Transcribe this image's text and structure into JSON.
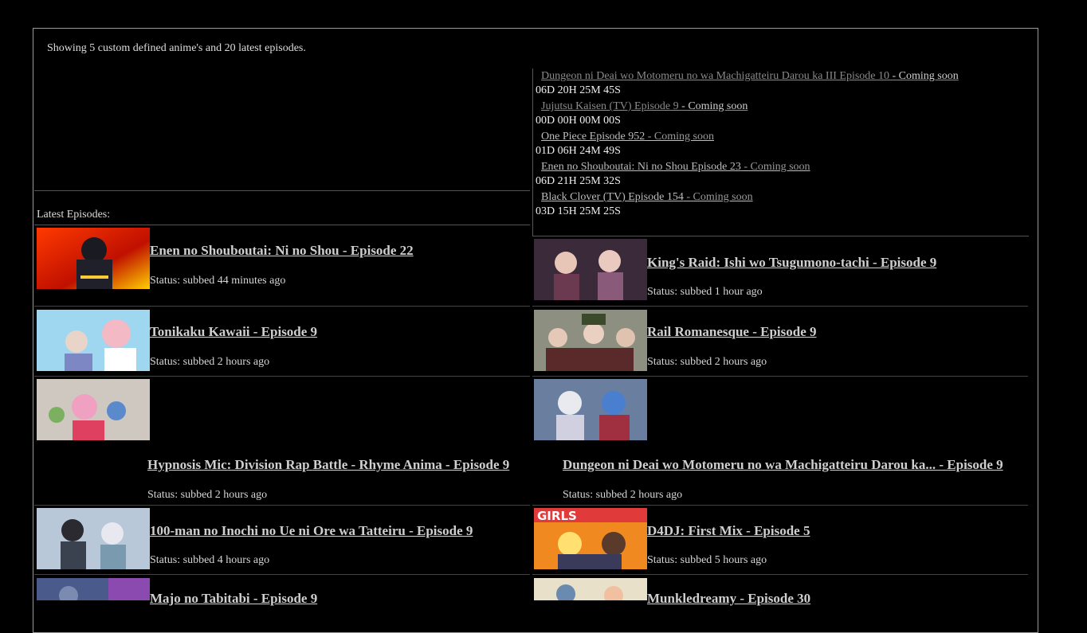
{
  "summary": "Showing 5 custom defined anime's and 20 latest episodes.",
  "latest_label": "Latest Episodes:",
  "upcoming": [
    {
      "title": "Dungeon ni Deai wo Motomeru no wa Machigatteiru Darou ka III Episode 10",
      "soon": " - Coming soon",
      "countdown": "06D 20H 25M 45S"
    },
    {
      "title": "Jujutsu Kaisen (TV) Episode 9",
      "soon": " - Coming soon",
      "countdown": "00D 00H 00M 00S"
    },
    {
      "title": "One Piece Episode 952",
      "soon": " - Coming soon",
      "countdown": "01D 06H 24M 49S"
    },
    {
      "title": "Enen no Shouboutai: Ni no Shou Episode 23",
      "soon": " - Coming soon",
      "countdown": "06D 21H 25M 32S"
    },
    {
      "title": "Black Clover (TV) Episode 154",
      "soon": " - Coming soon",
      "countdown": "03D 15H 25M 25S"
    }
  ],
  "episodes": [
    {
      "title": "Enen no Shouboutai: Ni no Shou - Episode 22",
      "status": "Status: subbed 44 minutes ago"
    },
    {
      "title": "King's Raid: Ishi wo Tsugumono-tachi - Episode 9",
      "status": "Status: subbed 1 hour ago"
    },
    {
      "title": "Tonikaku Kawaii - Episode 9",
      "status": "Status: subbed 2 hours ago"
    },
    {
      "title": "Rail Romanesque - Episode 9",
      "status": "Status: subbed 2 hours ago"
    },
    {
      "title": "Hypnosis Mic: Division Rap Battle - Rhyme Anima - Episode 9",
      "status": "Status: subbed 2 hours ago"
    },
    {
      "title": "Dungeon ni Deai wo Motomeru no wa Machigatteiru Darou ka... - Episode 9",
      "status": "Status: subbed 2 hours ago"
    },
    {
      "title": "100-man no Inochi no Ue ni Ore wa Tatteiru - Episode 9",
      "status": "Status: subbed 4 hours ago"
    },
    {
      "title": "D4DJ: First Mix - Episode 5",
      "status": "Status: subbed 5 hours ago"
    },
    {
      "title": "Majo no Tabitabi - Episode 9",
      "status": ""
    },
    {
      "title": "Munkledreamy - Episode 30",
      "status": ""
    }
  ],
  "thumb_text": {
    "d4dj": "GIRLS"
  },
  "colors": {
    "background": "#000000",
    "link": "#cfcfcf",
    "dim_link": "#8a8a8a",
    "border": "#9a9a9a"
  }
}
